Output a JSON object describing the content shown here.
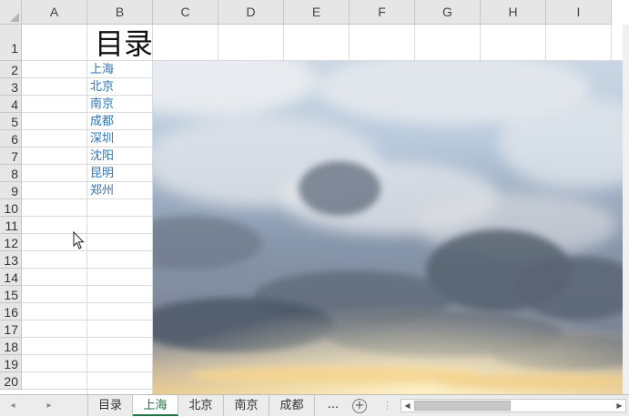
{
  "columns": [
    "A",
    "B",
    "C",
    "D",
    "E",
    "F",
    "G",
    "H",
    "I"
  ],
  "rows": [
    "1",
    "2",
    "3",
    "4",
    "5",
    "6",
    "7",
    "8",
    "9",
    "10",
    "11",
    "12",
    "13",
    "14",
    "15",
    "16",
    "17",
    "18",
    "19",
    "20"
  ],
  "title": "目录",
  "links": [
    "上海",
    "北京",
    "南京",
    "成都",
    "深圳",
    "沈阳",
    "昆明",
    "郑州"
  ],
  "tabs": [
    "目录",
    "上海",
    "北京",
    "南京",
    "成都"
  ],
  "active_tab": "上海",
  "more_tabs_label": "...",
  "add_sheet_label": "+",
  "nav_prev_label": "◂",
  "nav_next_label": "▸",
  "colors": {
    "header_bg": "#e6e6e6",
    "link": "#2e75b6",
    "active_tab": "#217346",
    "grid": "#dadada"
  }
}
